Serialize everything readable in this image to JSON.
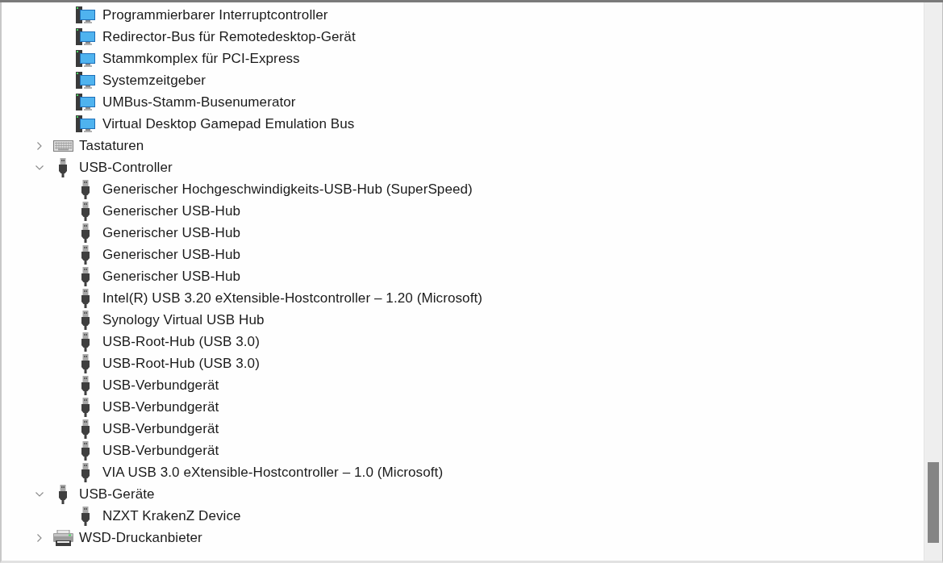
{
  "tree": {
    "continued_items": [
      {
        "label": "Programmierbarer Interruptcontroller",
        "kind": "system"
      },
      {
        "label": "Redirector-Bus für Remotedesktop-Gerät",
        "kind": "system"
      },
      {
        "label": "Stammkomplex für PCI-Express",
        "kind": "system"
      },
      {
        "label": "Systemzeitgeber",
        "kind": "system"
      },
      {
        "label": "UMBus-Stamm-Busenumerator",
        "kind": "system"
      },
      {
        "label": "Virtual Desktop Gamepad Emulation Bus",
        "kind": "system"
      }
    ],
    "categories": [
      {
        "label": "Tastaturen",
        "kind": "keyboard",
        "expanded": false
      },
      {
        "label": "USB-Controller",
        "kind": "usb",
        "expanded": true,
        "children": [
          {
            "label": "Generischer Hochgeschwindigkeits-USB-Hub (SuperSpeed)",
            "kind": "usb"
          },
          {
            "label": "Generischer USB-Hub",
            "kind": "usb"
          },
          {
            "label": "Generischer USB-Hub",
            "kind": "usb"
          },
          {
            "label": "Generischer USB-Hub",
            "kind": "usb"
          },
          {
            "label": "Generischer USB-Hub",
            "kind": "usb"
          },
          {
            "label": "Intel(R) USB 3.20 eXtensible-Hostcontroller – 1.20 (Microsoft)",
            "kind": "usb"
          },
          {
            "label": "Synology Virtual USB Hub",
            "kind": "usb"
          },
          {
            "label": "USB-Root-Hub (USB 3.0)",
            "kind": "usb"
          },
          {
            "label": "USB-Root-Hub (USB 3.0)",
            "kind": "usb"
          },
          {
            "label": "USB-Verbundgerät",
            "kind": "usb"
          },
          {
            "label": "USB-Verbundgerät",
            "kind": "usb"
          },
          {
            "label": "USB-Verbundgerät",
            "kind": "usb"
          },
          {
            "label": "USB-Verbundgerät",
            "kind": "usb"
          },
          {
            "label": "VIA USB 3.0 eXtensible-Hostcontroller – 1.0 (Microsoft)",
            "kind": "usb"
          }
        ]
      },
      {
        "label": "USB-Geräte",
        "kind": "usb",
        "expanded": true,
        "children": [
          {
            "label": "NZXT KrakenZ Device",
            "kind": "usb"
          }
        ]
      },
      {
        "label": "WSD-Druckanbieter",
        "kind": "printer",
        "expanded": false
      }
    ]
  }
}
